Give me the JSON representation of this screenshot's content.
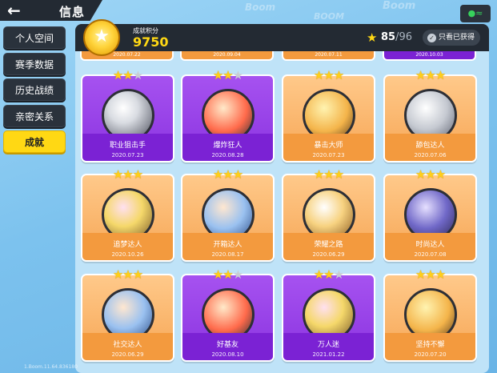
{
  "header": {
    "back_icon": "back-arrow-icon",
    "title": "信息"
  },
  "decor": [
    "Boom",
    "Boom",
    "BOOM"
  ],
  "sidebar": {
    "items": [
      {
        "label": "个人空间",
        "active": false
      },
      {
        "label": "赛季数据",
        "active": false
      },
      {
        "label": "历史战绩",
        "active": false
      },
      {
        "label": "亲密关系",
        "active": false
      },
      {
        "label": "成就",
        "active": true
      }
    ]
  },
  "achievement_header": {
    "score_label": "成就积分",
    "score": "9750",
    "count": "85",
    "total": "/96",
    "filter_label": "只看已获得"
  },
  "peek_dates": [
    "2020.07.22",
    "2020.09.04",
    "2020.07.11",
    "2020.10.03"
  ],
  "cards": [
    {
      "name": "职业狙击手",
      "date": "2020.07.23",
      "color": "purple",
      "stars": 2
    },
    {
      "name": "爆炸狂人",
      "date": "2020.08.28",
      "color": "purple",
      "stars": 2
    },
    {
      "name": "暴击大师",
      "date": "2020.07.23",
      "color": "orange",
      "stars": 3
    },
    {
      "name": "舔包达人",
      "date": "2020.07.06",
      "color": "orange",
      "stars": 3
    },
    {
      "name": "追梦达人",
      "date": "2020.10.26",
      "color": "orange",
      "stars": 3
    },
    {
      "name": "开箱达人",
      "date": "2020.08.17",
      "color": "orange",
      "stars": 3
    },
    {
      "name": "荣耀之路",
      "date": "2020.06.29",
      "color": "orange",
      "stars": 3
    },
    {
      "name": "时尚达人",
      "date": "2020.07.08",
      "color": "orange",
      "stars": 3
    },
    {
      "name": "社交达人",
      "date": "2020.06.29",
      "color": "orange",
      "stars": 3
    },
    {
      "name": "好基友",
      "date": "2020.08.10",
      "color": "purple",
      "stars": 2
    },
    {
      "name": "万人迷",
      "date": "2021.01.22",
      "color": "purple",
      "stars": 2
    },
    {
      "name": "坚持不懈",
      "date": "2020.07.20",
      "color": "orange",
      "stars": 3
    }
  ],
  "version": "1.Boom.11.64.836180",
  "colors": {
    "accent": "#ffd814",
    "dark": "#232a33",
    "purple": "#8b34e0",
    "orange": "#f6a655"
  }
}
